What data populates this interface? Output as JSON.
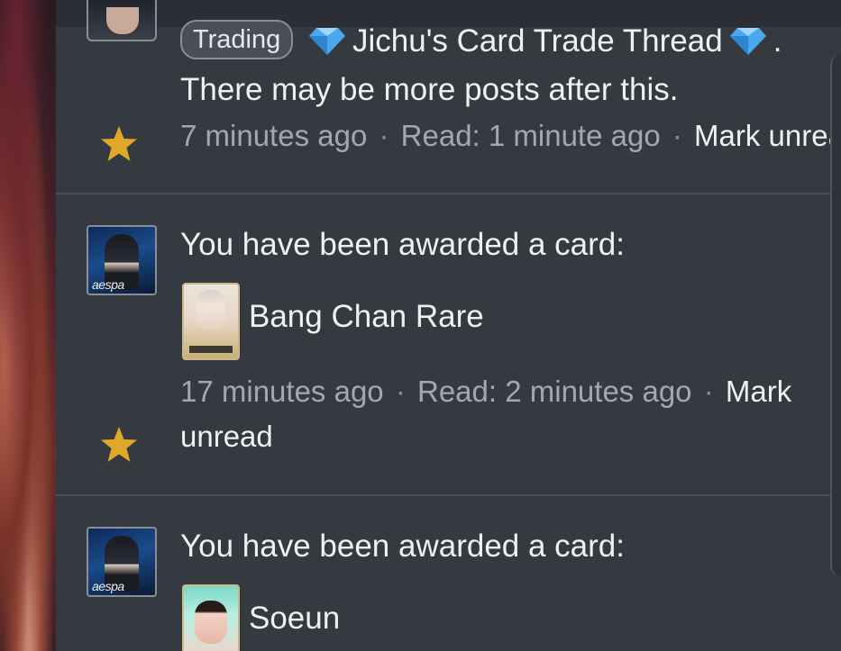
{
  "alerts": [
    {
      "prefix": "Trading",
      "thread_title": "Jichu's Card Trade Thread",
      "trailing": ".",
      "message": "There may be more posts after this.",
      "time": "7 minutes ago",
      "sep1": "·",
      "read": "Read: 1 minute ago",
      "sep2": "·",
      "mark_unread": "Mark unread"
    },
    {
      "avatar_tag": "aespa",
      "message": "You have been awarded a card:",
      "card_name": "Bang Chan Rare",
      "time": "17 minutes ago",
      "sep1": "·",
      "read": "Read: 2 minutes ago",
      "sep2": "·",
      "mark_unread_line1": "Mark",
      "mark_unread_line2": "unread"
    },
    {
      "avatar_tag": "aespa",
      "message": "You have been awarded a card:",
      "card_name": "Soeun"
    }
  ],
  "colors": {
    "panel_bg": "#353940",
    "star": "#e0a828",
    "gem": "#4aa8ec",
    "text_primary": "#eef0f3",
    "text_muted": "#a3a8b0"
  },
  "icons": {
    "star": "star-icon",
    "gem": "gem-icon"
  }
}
